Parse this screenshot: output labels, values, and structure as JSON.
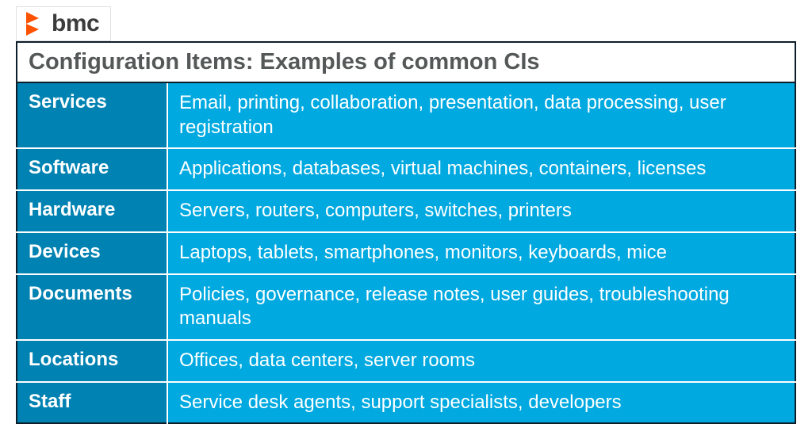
{
  "brand": {
    "name": "bmc",
    "accent": "#fd5200"
  },
  "title": "Configuration Items: Examples of common CIs",
  "rows": [
    {
      "category": "Services",
      "examples": "Email, printing, collaboration, presentation, data processing, user registration"
    },
    {
      "category": "Software",
      "examples": "Applications, databases, virtual machines, containers, licenses"
    },
    {
      "category": "Hardware",
      "examples": "Servers, routers, computers, switches, printers"
    },
    {
      "category": "Devices",
      "examples": "Laptops, tablets, smartphones, monitors, keyboards, mice"
    },
    {
      "category": "Documents",
      "examples": "Policies, governance, release notes, user guides, troubleshooting manuals"
    },
    {
      "category": "Locations",
      "examples": "Offices, data centers, server rooms"
    },
    {
      "category": "Staff",
      "examples": "Service desk agents, support specialists, developers"
    }
  ]
}
